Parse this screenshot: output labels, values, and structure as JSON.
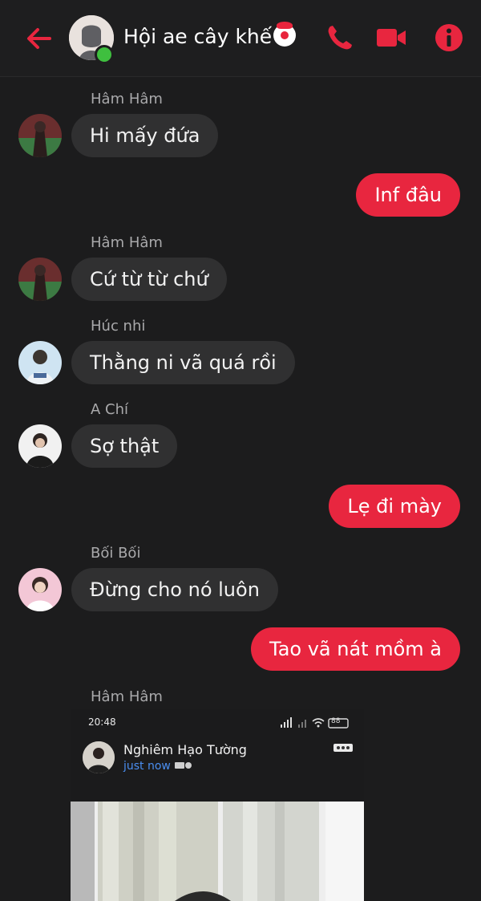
{
  "header": {
    "title": "Hội ae cây khế",
    "title_emoji": "clown-face-icon",
    "accent": "#e8263f"
  },
  "messages": {
    "m1": {
      "sender": "Hâm Hâm",
      "text": "Hi mấy đứa"
    },
    "m2": {
      "text": "Inf đâu"
    },
    "m3": {
      "sender": "Hâm Hâm",
      "text": "Cứ từ từ chứ"
    },
    "m4": {
      "sender": "Húc nhi",
      "text": "Thằng ni vã quá rồi"
    },
    "m5": {
      "sender": "A Chí",
      "text": "Sợ thật"
    },
    "m6": {
      "text": "Lẹ đi mày"
    },
    "m7": {
      "sender": "Bối Bối",
      "text": "Đừng cho nó luôn"
    },
    "m8": {
      "text": "Tao vã nát mồm à"
    },
    "m9": {
      "sender": "Hâm Hâm"
    }
  },
  "shared_screenshot": {
    "status_time": "20:48",
    "battery": "88",
    "post_author": "Nghiêm Hạo Tường",
    "post_time": "just now"
  }
}
